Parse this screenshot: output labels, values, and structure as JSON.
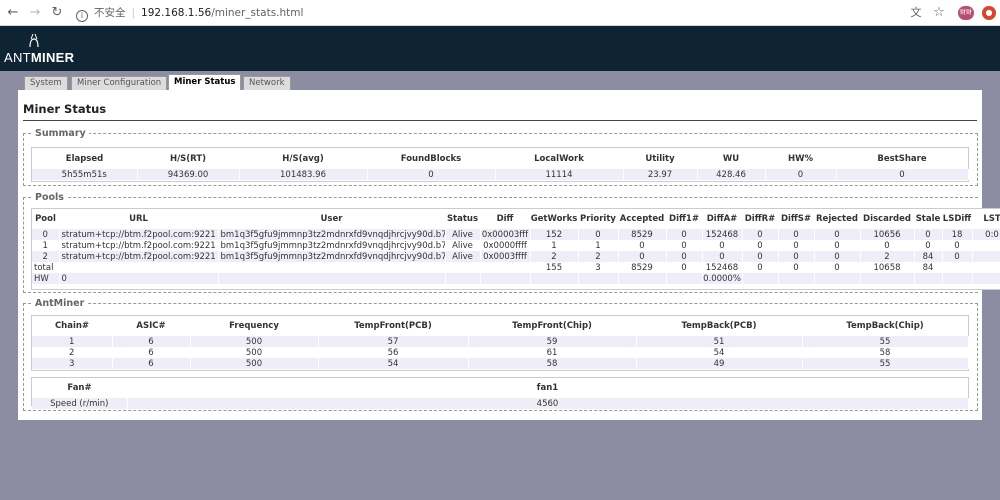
{
  "browser": {
    "back_icon": "arrow-left-icon",
    "forward_icon": "arrow-right-icon",
    "reload_icon": "reload-icon",
    "security_label": "不安全",
    "url_host": "192.168.1.56",
    "url_path": "/miner_stats.html",
    "avatar_text": "财财"
  },
  "header": {
    "logo_part1": "ANT",
    "logo_part2": "MINER"
  },
  "tabs": [
    {
      "label": "System"
    },
    {
      "label": "Miner Configuration"
    },
    {
      "label": "Miner Status"
    },
    {
      "label": "Network"
    }
  ],
  "page_title": "Miner Status",
  "summary": {
    "legend": "Summary",
    "headers": [
      "Elapsed",
      "H/S(RT)",
      "H/S(avg)",
      "FoundBlocks",
      "LocalWork",
      "Utility",
      "WU",
      "HW%",
      "BestShare"
    ],
    "row": [
      "5h55m51s",
      "94369.00",
      "101483.96",
      "0",
      "11114",
      "23.97",
      "428.46",
      "0",
      "0"
    ]
  },
  "pools": {
    "legend": "Pools",
    "headers": [
      "Pool",
      "URL",
      "User",
      "Status",
      "Diff",
      "GetWorks",
      "Priority",
      "Accepted",
      "Diff1#",
      "DiffA#",
      "DiffR#",
      "DiffS#",
      "Rejected",
      "Discarded",
      "Stale",
      "LSDiff",
      "LST"
    ],
    "rows": [
      [
        "0",
        "stratum+tcp://btm.f2pool.com:9221",
        "bm1q3f5gfu9jmmnp3tz2mdnrxfd9vnqdjhrcjvy90d.b7",
        "Alive",
        "0x00003fff",
        "152",
        "0",
        "8529",
        "0",
        "152468",
        "0",
        "0",
        "0",
        "10656",
        "0",
        "18",
        "0:0"
      ],
      [
        "1",
        "stratum+tcp://btm.f2pool.com:9221",
        "bm1q3f5gfu9jmmnp3tz2mdnrxfd9vnqdjhrcjvy90d.b7",
        "Alive",
        "0x0000ffff",
        "1",
        "1",
        "0",
        "0",
        "0",
        "0",
        "0",
        "0",
        "0",
        "0",
        "0",
        ""
      ],
      [
        "2",
        "stratum+tcp://btm.f2pool.com:9221",
        "bm1q3f5gfu9jmmnp3tz2mdnrxfd9vnqdjhrcjvy90d.b7",
        "Alive",
        "0x0003ffff",
        "2",
        "2",
        "0",
        "0",
        "0",
        "0",
        "0",
        "0",
        "2",
        "84",
        "0",
        ""
      ],
      [
        "total",
        "",
        "",
        "",
        "",
        "155",
        "3",
        "8529",
        "0",
        "152468",
        "0",
        "0",
        "0",
        "10658",
        "84",
        "",
        ""
      ],
      [
        "HW",
        "0",
        "",
        "",
        "",
        "",
        "",
        "",
        "",
        "0.0000%",
        "",
        "",
        "",
        "",
        "",
        "",
        ""
      ]
    ]
  },
  "antminer": {
    "legend": "AntMiner",
    "headers": [
      "Chain#",
      "ASIC#",
      "Frequency",
      "TempFront(PCB)",
      "TempFront(Chip)",
      "TempBack(PCB)",
      "TempBack(Chip)"
    ],
    "rows": [
      [
        "1",
        "6",
        "500",
        "57",
        "59",
        "51",
        "55"
      ],
      [
        "2",
        "6",
        "500",
        "56",
        "61",
        "54",
        "58"
      ],
      [
        "3",
        "6",
        "500",
        "54",
        "58",
        "49",
        "55"
      ]
    ],
    "fan_headers": [
      "Fan#",
      "fan1"
    ],
    "fan_row": [
      "Speed (r/min)",
      "4560"
    ]
  }
}
